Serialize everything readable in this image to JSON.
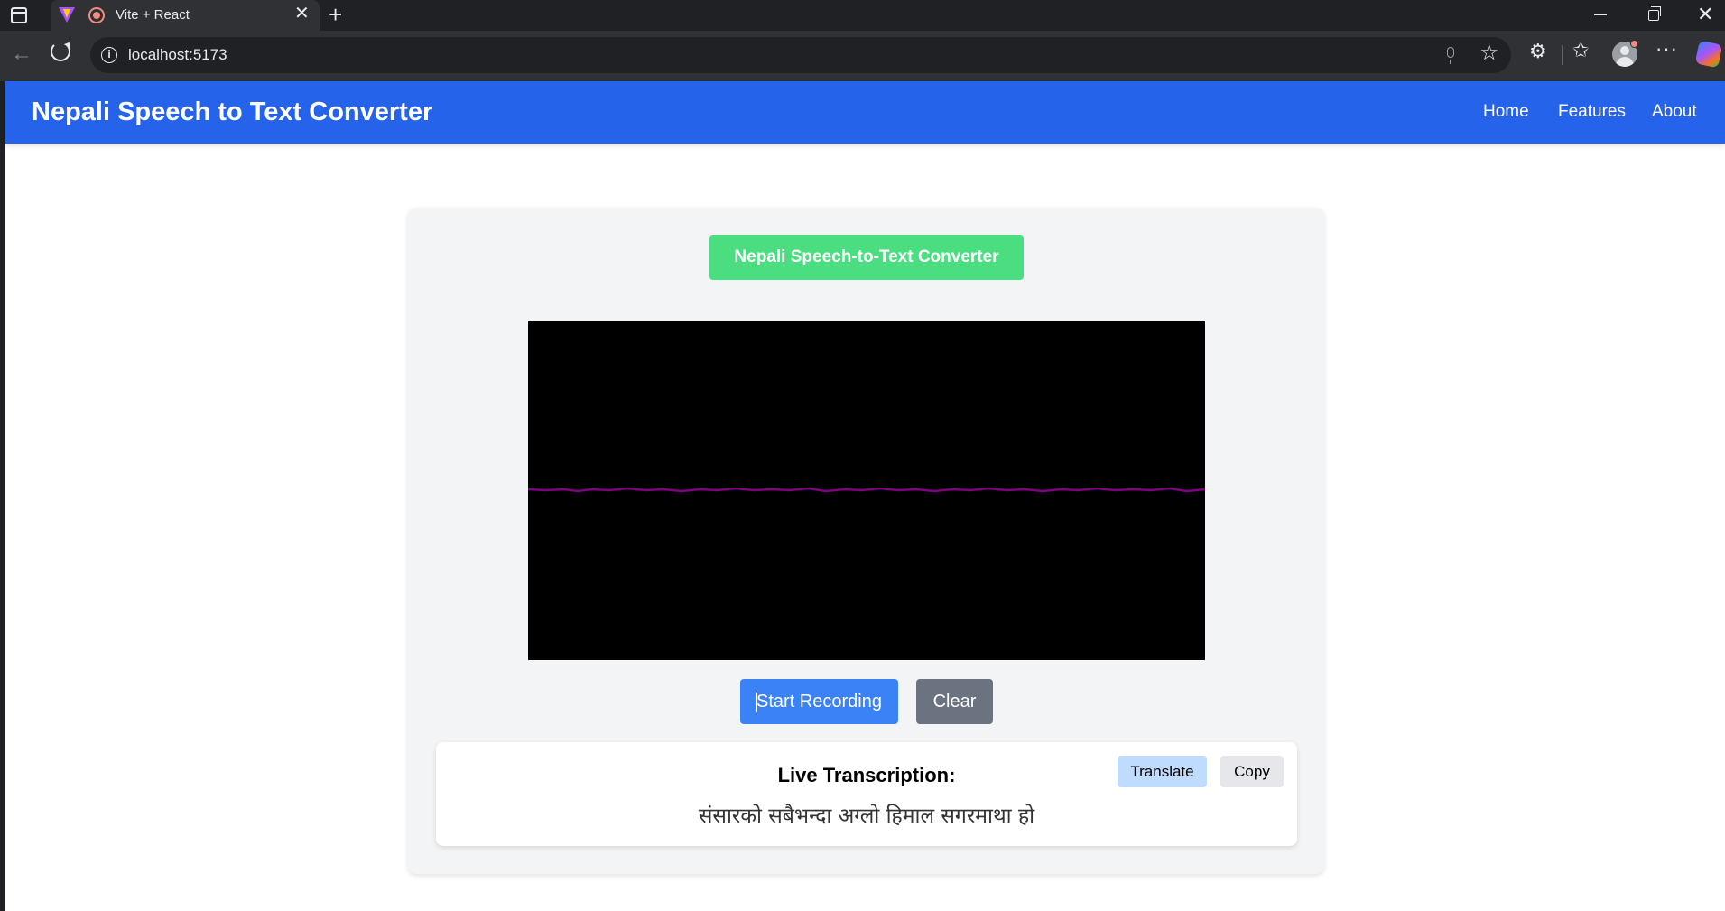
{
  "browser": {
    "tab_title": "Vite + React",
    "tab_close": "✕",
    "new_tab": "+",
    "url": "localhost:5173",
    "win_close": "✕",
    "star": "☆",
    "extensions": "⚙",
    "favorites": "✩",
    "more": "···",
    "back": "←"
  },
  "app": {
    "title": "Nepali Speech to Text Converter",
    "nav": {
      "home": "Home",
      "features": "Features",
      "about": "About"
    }
  },
  "converter": {
    "heading": "Nepali Speech-to-Text Converter",
    "start_label": "Start Recording",
    "clear_label": "Clear",
    "waveform_color": "#800080"
  },
  "transcription": {
    "title": "Live Transcription:",
    "text": "संसारको सबैभन्दा अग्लो हिमाल सगरमाथा हो",
    "translate_label": "Translate",
    "copy_label": "Copy"
  },
  "colors": {
    "nav_bg": "#2563eb",
    "heading_bg": "#4ade80",
    "start_bg": "#3b82f6",
    "clear_bg": "#6b7280",
    "translate_bg": "#bfdbfe",
    "copy_bg": "#e5e7eb"
  }
}
